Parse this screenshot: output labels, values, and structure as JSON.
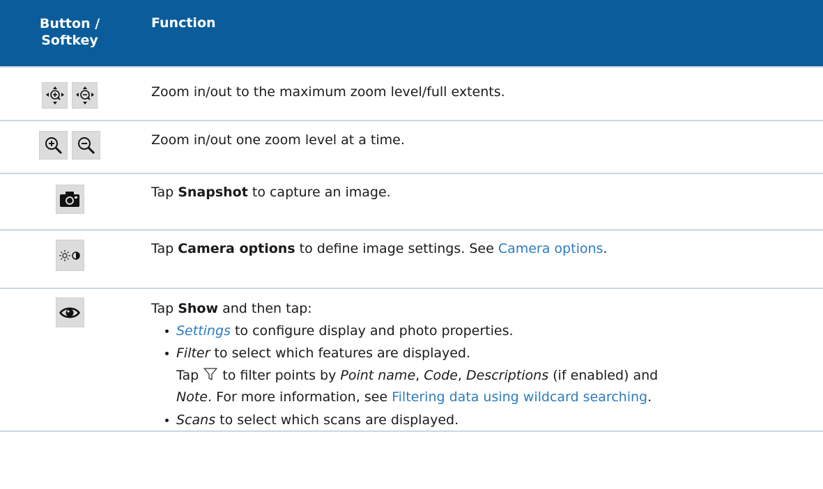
{
  "header": {
    "col1_line1": "Button /",
    "col1_line2": "Softkey",
    "col2": "Function"
  },
  "rows": {
    "zoom_extents": {
      "icons": [
        "zoom-in-extents-icon",
        "zoom-out-extents-icon"
      ],
      "text": "Zoom in/out to the maximum zoom level/full extents."
    },
    "zoom_level": {
      "icons": [
        "zoom-in-icon",
        "zoom-out-icon"
      ],
      "text": "Zoom in/out one zoom level at a time."
    },
    "snapshot": {
      "icon": "camera-icon",
      "pre": "Tap ",
      "bold": "Snapshot",
      "post": " to capture an image."
    },
    "camera_options": {
      "icon": "brightness-contrast-icon",
      "pre": "Tap ",
      "bold": "Camera options",
      "mid": " to define image settings. See ",
      "link": "Camera options",
      "post": "."
    },
    "show": {
      "icon": "eye-icon",
      "pre": "Tap ",
      "bold": "Show",
      "post": " and then tap:",
      "item1_link": "Settings",
      "item1_text": " to configure display and photo properties.",
      "item2_italic": "Filter",
      "item2_text": " to select which features are displayed.",
      "filter_pre": "Tap ",
      "filter_icon": "filter-icon",
      "filter_mid": " to filter points by ",
      "filter_f1": "Point name",
      "filter_sep1": ", ",
      "filter_f2": "Code",
      "filter_sep2": ", ",
      "filter_f3": "Descriptions",
      "filter_mid2": " (if enabled) and",
      "filter_f4": "Note",
      "filter_post": ". For more information, see ",
      "filter_link": "Filtering data using wildcard searching",
      "filter_end": ".",
      "item3_italic": "Scans",
      "item3_text": " to select which scans are displayed."
    }
  },
  "colors": {
    "header_bg": "#0a5c9a",
    "link": "#2b7bbf",
    "row_border": "#c9d6e2",
    "icon_bg": "#dcdcdc"
  }
}
